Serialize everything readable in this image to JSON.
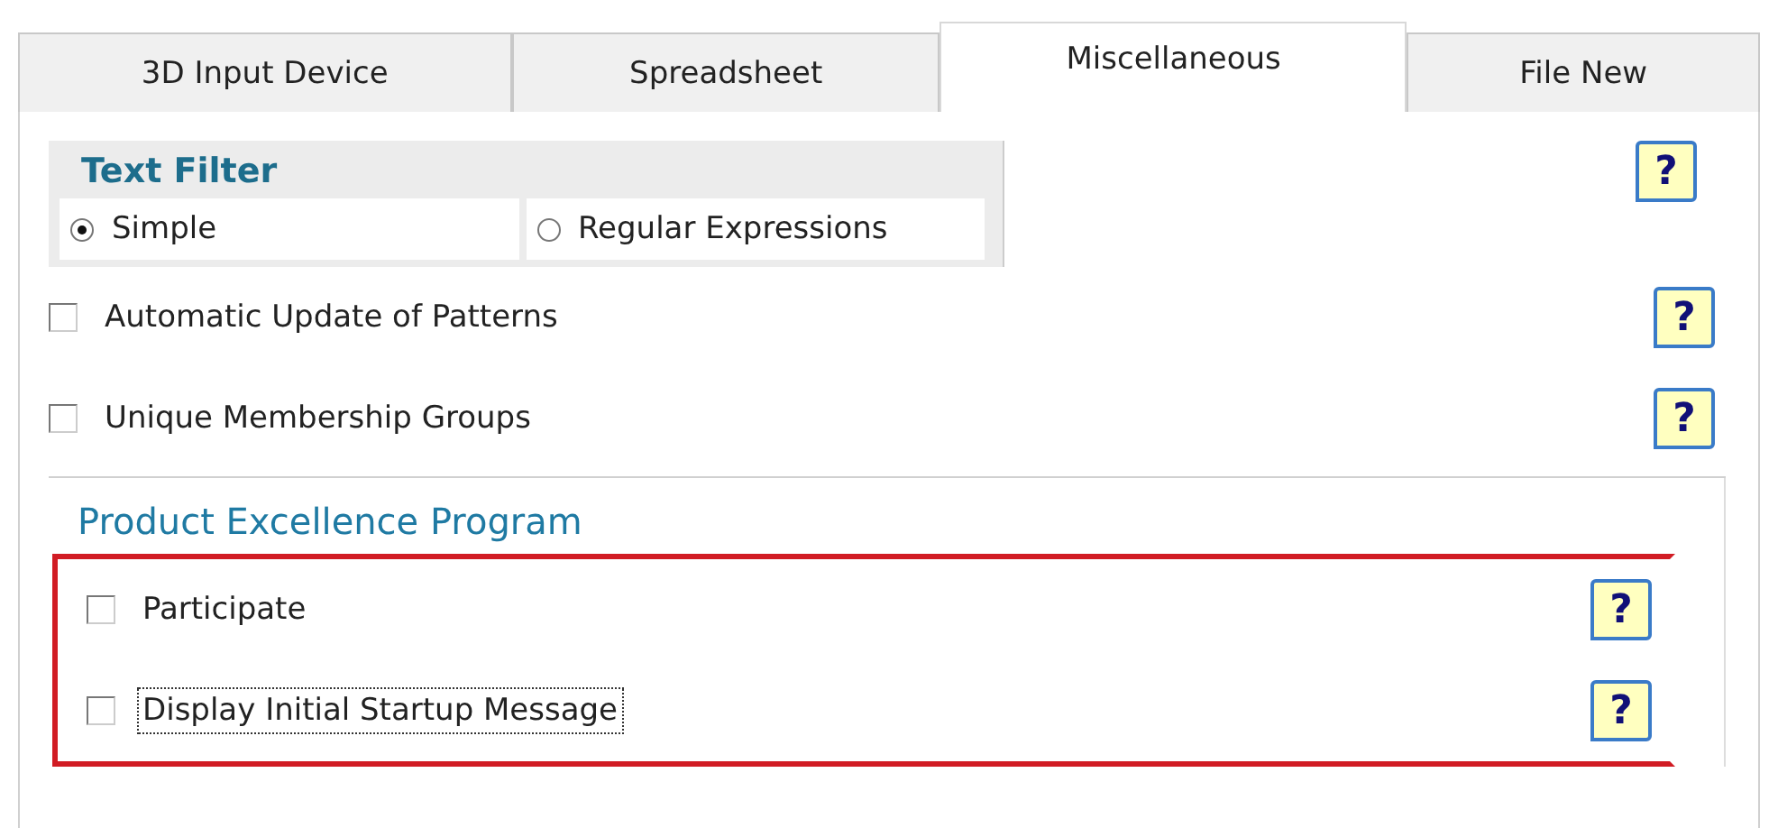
{
  "tabs": [
    {
      "label": "3D Input Device",
      "selected": false
    },
    {
      "label": "Spreadsheet",
      "selected": false
    },
    {
      "label": "Miscellaneous",
      "selected": true
    },
    {
      "label": "File New",
      "selected": false
    }
  ],
  "text_filter": {
    "title": "Text Filter",
    "help": "?",
    "options": [
      {
        "label": "Simple",
        "selected": true
      },
      {
        "label": "Regular Expressions",
        "selected": false
      }
    ]
  },
  "options": [
    {
      "label": "Automatic Update of Patterns",
      "checked": false,
      "help": "?"
    },
    {
      "label": "Unique Membership Groups",
      "checked": false,
      "help": "?"
    }
  ],
  "product_excellence": {
    "title": "Product Excellence Program",
    "highlighted": true,
    "options": [
      {
        "label": "Participate",
        "checked": false,
        "focused": false,
        "help": "?"
      },
      {
        "label": "Display Initial Startup Message",
        "checked": false,
        "focused": true,
        "help": "?"
      }
    ]
  }
}
